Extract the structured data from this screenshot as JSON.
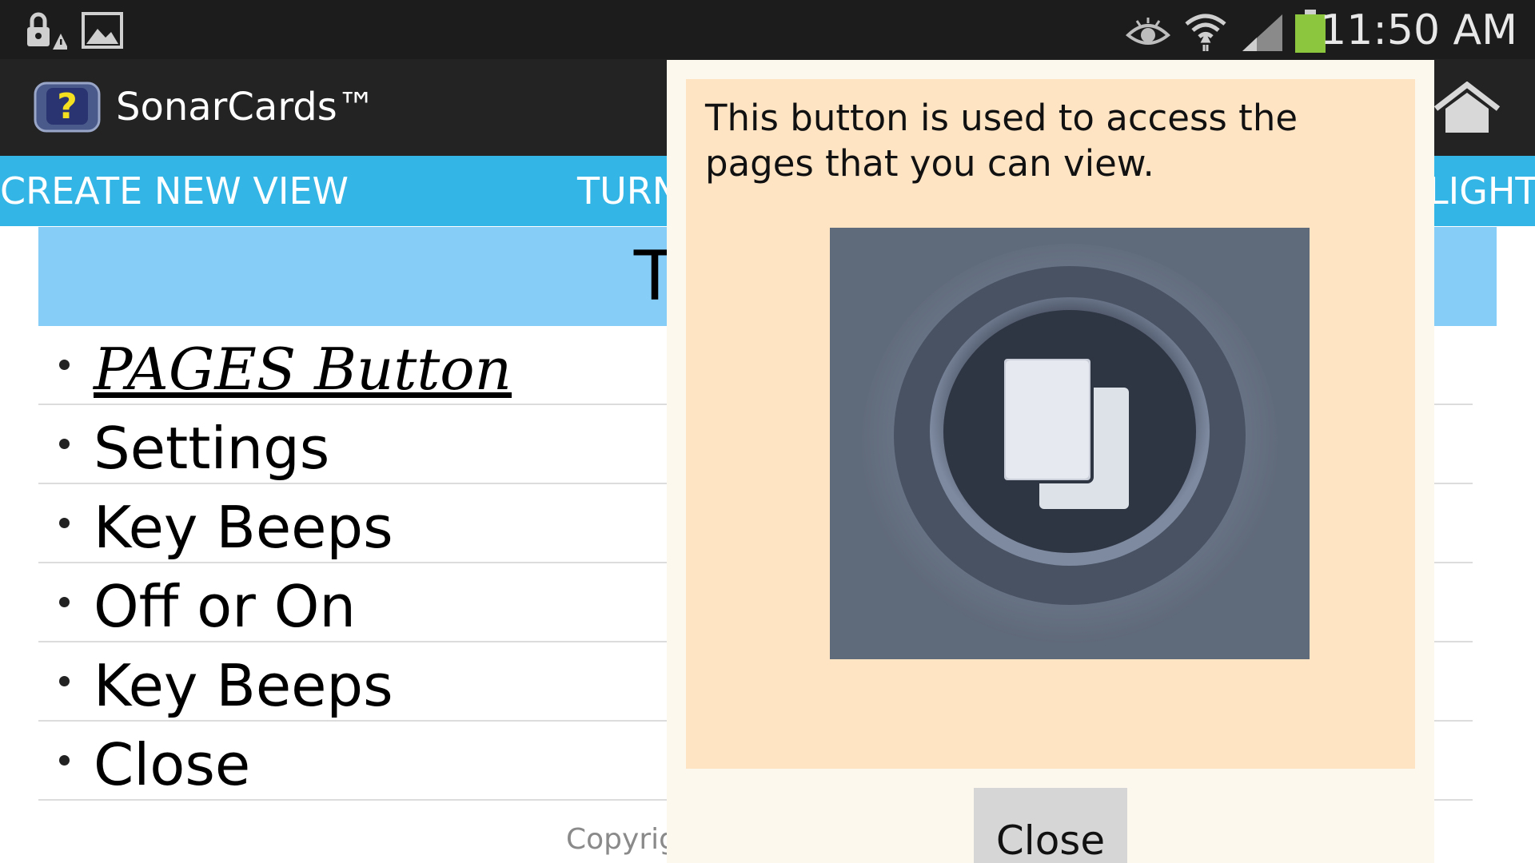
{
  "status_bar": {
    "time": "11:50 AM",
    "icons": [
      "lock-warning-icon",
      "image-icon",
      "eye-icon",
      "wifi-icon",
      "signal-icon",
      "battery-icon"
    ],
    "battery_color": "#8cc63f"
  },
  "action_bar": {
    "app_title": "SonarCards™",
    "icons": [
      "app-logo-icon",
      "home-icon"
    ]
  },
  "tabs": {
    "create_new_view": "CREATE NEW VIEW",
    "turn": "TURN",
    "light": "LIGHT",
    "color": "#33b5e5"
  },
  "content": {
    "banner_title": "TURN O",
    "banner_color": "#86cdf7",
    "items": [
      {
        "label": "PAGES Button"
      },
      {
        "label": "Settings"
      },
      {
        "label": "Key Beeps"
      },
      {
        "label": "Off or On"
      },
      {
        "label": "Key Beeps"
      },
      {
        "label": "Close"
      }
    ],
    "copyright": "Copyrig"
  },
  "dialog": {
    "message": "This button is used to access the pages that you can view.",
    "image_icon": "pages-button-icon",
    "close_label": "Close",
    "panel_color": "#ffe4c4"
  }
}
